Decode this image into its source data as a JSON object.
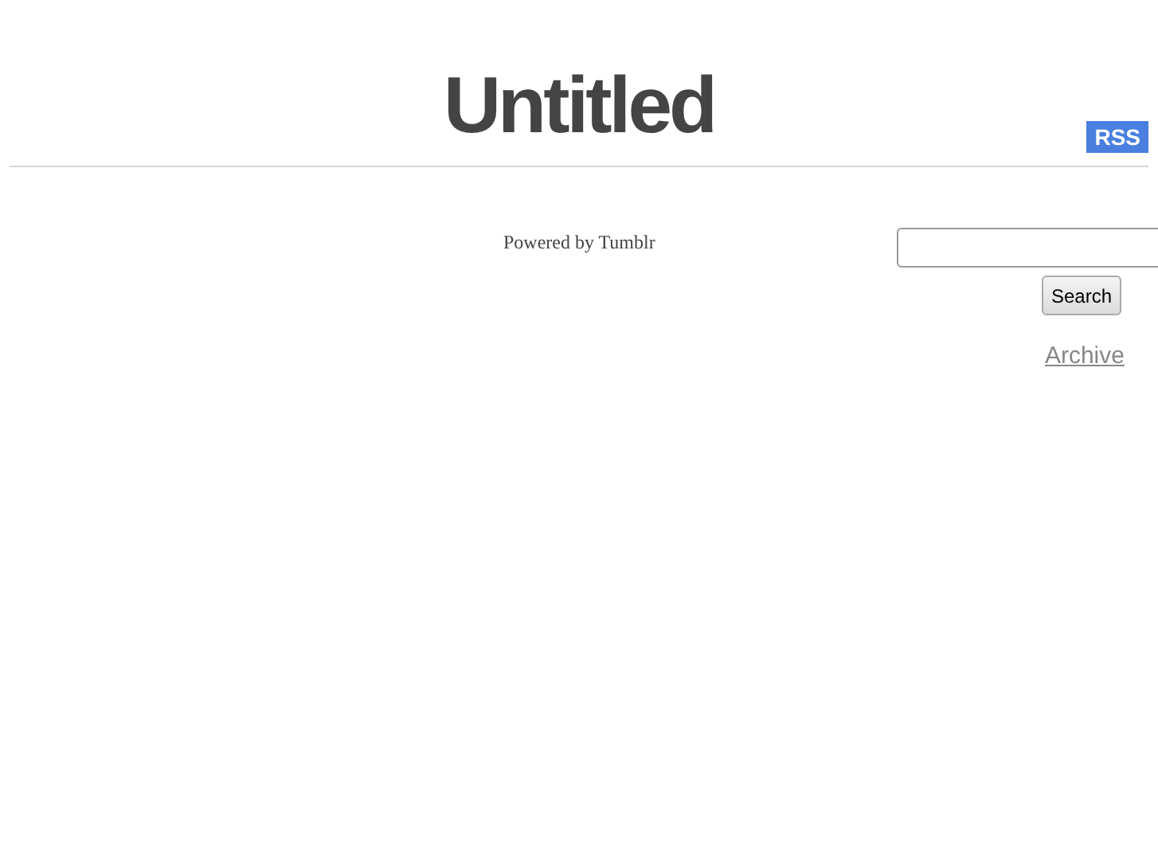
{
  "header": {
    "title": "Untitled",
    "rss": "RSS"
  },
  "footer": {
    "text": "Powered by Tumblr"
  },
  "sidebar": {
    "search_button": "Search",
    "archive_link": "Archive"
  }
}
